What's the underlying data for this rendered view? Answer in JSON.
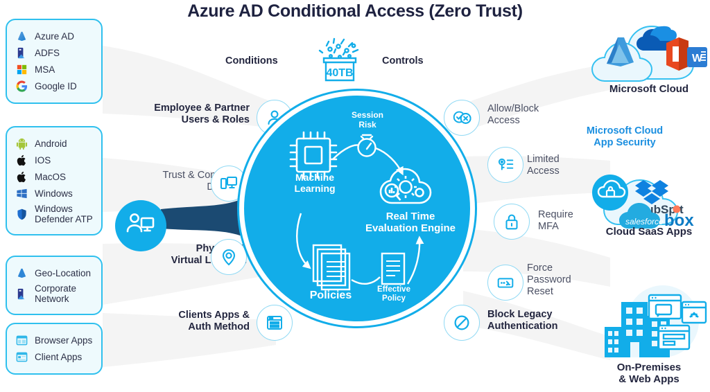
{
  "title": "Azure AD Conditional Access (Zero Trust)",
  "colors": {
    "accent_blue": "#12ADE9",
    "dark_navy": "#1E2240",
    "funnel_gray": "#F4F4F4",
    "card_fill": "#EEFAFD",
    "card_border": "#2FC0EE",
    "deep_blue": "#1B4A72"
  },
  "flow_headings": {
    "conditions": "Conditions",
    "controls": "Controls"
  },
  "signals_badge": {
    "label": "40TB",
    "icon": "signals-data-box-icon"
  },
  "source_cards": [
    {
      "id": "identity",
      "items": [
        {
          "label": "Azure AD",
          "icon": "azure-ad-icon"
        },
        {
          "label": "ADFS",
          "icon": "adfs-server-icon"
        },
        {
          "label": "MSA",
          "icon": "microsoft-squares-icon"
        },
        {
          "label": "Google ID",
          "icon": "google-g-icon"
        }
      ]
    },
    {
      "id": "devices",
      "items": [
        {
          "label": "Android",
          "icon": "android-icon"
        },
        {
          "label": "IOS",
          "icon": "apple-icon"
        },
        {
          "label": "MacOS",
          "icon": "apple-icon"
        },
        {
          "label": "Windows",
          "icon": "windows-logo-icon"
        },
        {
          "label": "Windows\nDefender ATP",
          "icon": "shield-icon"
        }
      ]
    },
    {
      "id": "network",
      "items": [
        {
          "label": "Geo-Location",
          "icon": "azure-ad-icon"
        },
        {
          "label": "Corporate\nNetwork",
          "icon": "adfs-server-icon"
        }
      ]
    },
    {
      "id": "apps",
      "items": [
        {
          "label": "Browser Apps",
          "icon": "browser-window-icon"
        },
        {
          "label": "Client Apps",
          "icon": "client-app-window-icon"
        }
      ]
    }
  ],
  "conditions": [
    {
      "label": "Employee & Partner\nUsers & Roles",
      "icon": "user-icon",
      "style": "dark"
    },
    {
      "label": "Trust & Compliant\nDevices",
      "icon": "devices-icon",
      "style": "gray"
    },
    {
      "label": "Physical &\nVirtual Location",
      "icon": "location-pin-icon",
      "style": "dark"
    },
    {
      "label": "Clients Apps &\nAuth Method",
      "icon": "app-window-icon",
      "style": "dark"
    }
  ],
  "user_device_node": {
    "icon": "user-device-icon"
  },
  "controls": [
    {
      "label": "Allow/Block\nAccess",
      "icon": "check-cross-icon",
      "style": "gray"
    },
    {
      "label": "Limited\nAccess",
      "icon": "key-list-icon",
      "style": "gray"
    },
    {
      "label": "Require\nMFA",
      "icon": "lock-icon",
      "style": "gray"
    },
    {
      "label": "Force\nPassword\nReset",
      "icon": "password-field-icon",
      "style": "gray"
    },
    {
      "label": "Block Legacy\nAuthentication",
      "icon": "block-icon",
      "style": "dark"
    }
  ],
  "core": {
    "engine_title": "Real Time\nEvaluation Engine",
    "nodes": [
      {
        "label": "Machine\nLearning",
        "icon": "cpu-chip-icon",
        "emphasis": "bold"
      },
      {
        "label": "Session\nRisk",
        "icon": "risk-gauge-icon",
        "emphasis": "bold"
      },
      {
        "label": "Policies",
        "icon": "policy-stack-icon",
        "emphasis": "bold"
      },
      {
        "label": "Effective\nPolicy",
        "icon": "single-policy-icon",
        "emphasis": "bold"
      }
    ],
    "cloud_icon": "cloud-analytics-gears-icon"
  },
  "destinations": [
    {
      "id": "microsoft-cloud",
      "caption": "Microsoft Cloud",
      "caption_color": "dark",
      "logos": [
        "azure-logo",
        "onedrive-logo",
        "office-logo",
        "word-logo"
      ]
    },
    {
      "id": "cloud-saas-apps",
      "caption": "Cloud SaaS Apps",
      "caption_color": "dark",
      "overline": "Microsoft Cloud\nApp Security",
      "logos": [
        "cloud-lock-logo",
        "dropbox-logo",
        "hubspot-logo",
        "salesforce-logo",
        "box-logo"
      ]
    },
    {
      "id": "on-premises-web-apps",
      "caption": "On-Premises\n& Web Apps",
      "caption_color": "dark",
      "logos": [
        "office-building-icon",
        "web-apps-icon"
      ]
    }
  ]
}
